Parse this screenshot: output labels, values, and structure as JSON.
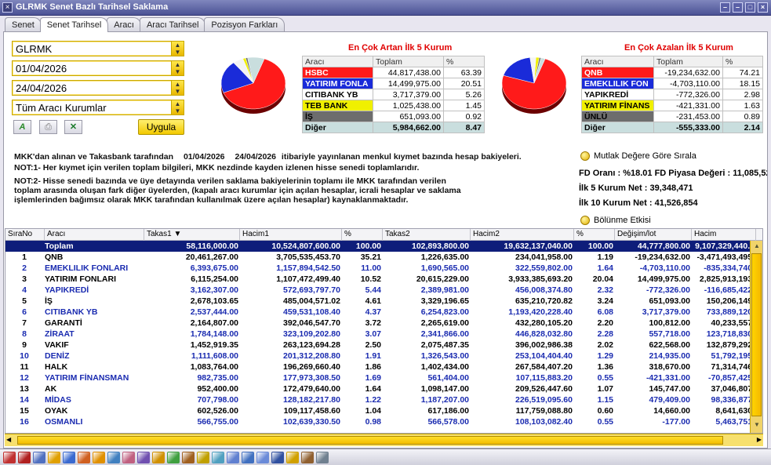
{
  "window": {
    "title": "GLRMK Senet Bazlı Tarihsel Saklama"
  },
  "tabs": [
    "Senet",
    "Senet Tarihsel",
    "Aracı",
    "Aracı Tarihsel",
    "Pozisyon Farkları"
  ],
  "form": {
    "symbol": "GLRMK",
    "start_date": "01/04/2026",
    "end_date": "24/04/2026",
    "broker_filter": "Tüm Aracı Kurumlar",
    "apply_label": "Uygula"
  },
  "top_gainers": {
    "title": "En Çok Artan İlk 5 Kurum",
    "headers": [
      "Aracı",
      "Toplam",
      "%"
    ],
    "rows": [
      {
        "name": "HSBC",
        "total": "44,817,438.00",
        "pct": "63.39",
        "color": "#ff1a1a",
        "text": "#ffffff"
      },
      {
        "name": "YATIRIM FONLA",
        "total": "14,499,975.00",
        "pct": "20.51",
        "color": "#1a2bd9",
        "text": "#ffffff"
      },
      {
        "name": "CITIBANK YB",
        "total": "3,717,379.00",
        "pct": "5.26",
        "color": "#ffffff",
        "text": "#000000"
      },
      {
        "name": "TEB BANK",
        "total": "1,025,438.00",
        "pct": "1.45",
        "color": "#f0f000",
        "text": "#000000"
      },
      {
        "name": "İŞ",
        "total": "651,093.00",
        "pct": "0.92",
        "color": "#6d6d6d",
        "text": "#000000"
      },
      {
        "name": "Diğer",
        "total": "5,984,662.00",
        "pct": "8.47",
        "color": "#c9dede",
        "text": "#000000"
      }
    ]
  },
  "top_losers": {
    "title": "En Çok Azalan İlk 5 Kurum",
    "headers": [
      "Aracı",
      "Toplam",
      "%"
    ],
    "rows": [
      {
        "name": "QNB",
        "total": "-19,234,632.00",
        "pct": "74.21",
        "color": "#ff1a1a",
        "text": "#ffffff"
      },
      {
        "name": "EMEKLILIK FON",
        "total": "-4,703,110.00",
        "pct": "18.15",
        "color": "#1a2bd9",
        "text": "#ffffff"
      },
      {
        "name": "YAPIKREDİ",
        "total": "-772,326.00",
        "pct": "2.98",
        "color": "#ffffff",
        "text": "#000000"
      },
      {
        "name": "YATIRIM FİNANS",
        "total": "-421,331.00",
        "pct": "1.63",
        "color": "#f0f000",
        "text": "#000000"
      },
      {
        "name": "ÜNLÜ",
        "total": "-231,453.00",
        "pct": "0.89",
        "color": "#6d6d6d",
        "text": "#000000"
      },
      {
        "name": "Diğer",
        "total": "-555,333.00",
        "pct": "2.14",
        "color": "#c9dede",
        "text": "#000000"
      }
    ]
  },
  "notes": {
    "line1_a": "MKK'dan alınan ve Takasbank tarafından",
    "line1_d1": "01/04/2026",
    "line1_d2": "24/04/2026",
    "line1_b": "itibariyle yayınlanan menkul kıymet bazında hesap bakiyeleri.",
    "not1": "NOT:1- Her kıymet için verilen toplam bilgileri, MKK nezdinde kayden izlenen hisse senedi toplamlarıdır.",
    "not2_l1": "NOT:2- Hisse senedi bazında ve üye detayında verilen saklama bakiyelerinin toplamı ile MKK tarafından verilen",
    "not2_l2": "toplam arasında oluşan fark diğer üyelerden, (kapalı aracı kurumlar için açılan hesaplar, icrali hesaplar ve saklama",
    "not2_l3": "işlemlerinden bağımsız olarak MKK tarafından kullanılmak üzere açılan hesaplar) kaynaklanmaktadır."
  },
  "right_info": {
    "sort_label": "Mutlak Değere Göre Sırala",
    "fd_line": "FD Oranı : %18.01 FD Piyasa Değeri : 11,085,52",
    "top5": "İlk 5 Kurum Net : 39,348,471",
    "top10": "İlk 10 Kurum Net : 41,526,854",
    "split_label": "Bölünme Etkisi"
  },
  "grid": {
    "headers": [
      "SıraNo",
      "Aracı",
      "Takas1",
      "Hacim1",
      "%",
      "Takas2",
      "Hacim2",
      "%",
      "Değişim/lot",
      "Hacim"
    ],
    "total": [
      "",
      "Toplam",
      "58,116,000.00",
      "10,524,807,600.00",
      "100.00",
      "102,893,800.00",
      "19,632,137,040.00",
      "100.00",
      "44,777,800.00",
      "9,107,329,440.0"
    ],
    "rows": [
      [
        "1",
        "QNB",
        "20,461,267.00",
        "3,705,535,453.70",
        "35.21",
        "1,226,635.00",
        "234,041,958.00",
        "1.19",
        "-19,234,632.00",
        "-3,471,493,495."
      ],
      [
        "2",
        "EMEKLILIK FONLARI",
        "6,393,675.00",
        "1,157,894,542.50",
        "11.00",
        "1,690,565.00",
        "322,559,802.00",
        "1.64",
        "-4,703,110.00",
        "-835,334,740."
      ],
      [
        "3",
        "YATIRIM FONLARI",
        "6,115,254.00",
        "1,107,472,499.40",
        "10.52",
        "20,615,229.00",
        "3,933,385,693.20",
        "20.04",
        "14,499,975.00",
        "2,825,913,193."
      ],
      [
        "4",
        "YAPIKREDİ",
        "3,162,307.00",
        "572,693,797.70",
        "5.44",
        "2,389,981.00",
        "456,008,374.80",
        "2.32",
        "-772,326.00",
        "-116,685,422."
      ],
      [
        "5",
        "İŞ",
        "2,678,103.65",
        "485,004,571.02",
        "4.61",
        "3,329,196.65",
        "635,210,720.82",
        "3.24",
        "651,093.00",
        "150,206,149."
      ],
      [
        "6",
        "CITIBANK YB",
        "2,537,444.00",
        "459,531,108.40",
        "4.37",
        "6,254,823.00",
        "1,193,420,228.40",
        "6.08",
        "3,717,379.00",
        "733,889,120."
      ],
      [
        "7",
        "GARANTİ",
        "2,164,807.00",
        "392,046,547.70",
        "3.72",
        "2,265,619.00",
        "432,280,105.20",
        "2.20",
        "100,812.00",
        "40,233,557."
      ],
      [
        "8",
        "ZİRAAT",
        "1,784,148.00",
        "323,109,202.80",
        "3.07",
        "2,341,866.00",
        "446,828,032.80",
        "2.28",
        "557,718.00",
        "123,718,830."
      ],
      [
        "9",
        "VAKIF",
        "1,452,919.35",
        "263,123,694.28",
        "2.50",
        "2,075,487.35",
        "396,002,986.38",
        "2.02",
        "622,568.00",
        "132,879,292."
      ],
      [
        "10",
        "DENİZ",
        "1,111,608.00",
        "201,312,208.80",
        "1.91",
        "1,326,543.00",
        "253,104,404.40",
        "1.29",
        "214,935.00",
        "51,792,195."
      ],
      [
        "11",
        "HALK",
        "1,083,764.00",
        "196,269,660.40",
        "1.86",
        "1,402,434.00",
        "267,584,407.20",
        "1.36",
        "318,670.00",
        "71,314,746."
      ],
      [
        "12",
        "YATIRIM FİNANSMAN",
        "982,735.00",
        "177,973,308.50",
        "1.69",
        "561,404.00",
        "107,115,883.20",
        "0.55",
        "-421,331.00",
        "-70,857,425."
      ],
      [
        "13",
        "AK",
        "952,400.00",
        "172,479,640.00",
        "1.64",
        "1,098,147.00",
        "209,526,447.60",
        "1.07",
        "145,747.00",
        "37,046,807."
      ],
      [
        "14",
        "MİDAS",
        "707,798.00",
        "128,182,217.80",
        "1.22",
        "1,187,207.00",
        "226,519,095.60",
        "1.15",
        "479,409.00",
        "98,336,877."
      ],
      [
        "15",
        "OYAK",
        "602,526.00",
        "109,117,458.60",
        "1.04",
        "617,186.00",
        "117,759,088.80",
        "0.60",
        "14,660.00",
        "8,641,630."
      ],
      [
        "16",
        "OSMANLI",
        "566,755.00",
        "102,639,330.50",
        "0.98",
        "566,578.00",
        "108,103,082.40",
        "0.55",
        "-177.00",
        "5,463,751."
      ]
    ]
  },
  "colors": {
    "row_alt_text": "#1a2bb0",
    "row_text": "#000000",
    "total_bg": "#0e1d7a",
    "accent_yellow": "#f5c800"
  }
}
